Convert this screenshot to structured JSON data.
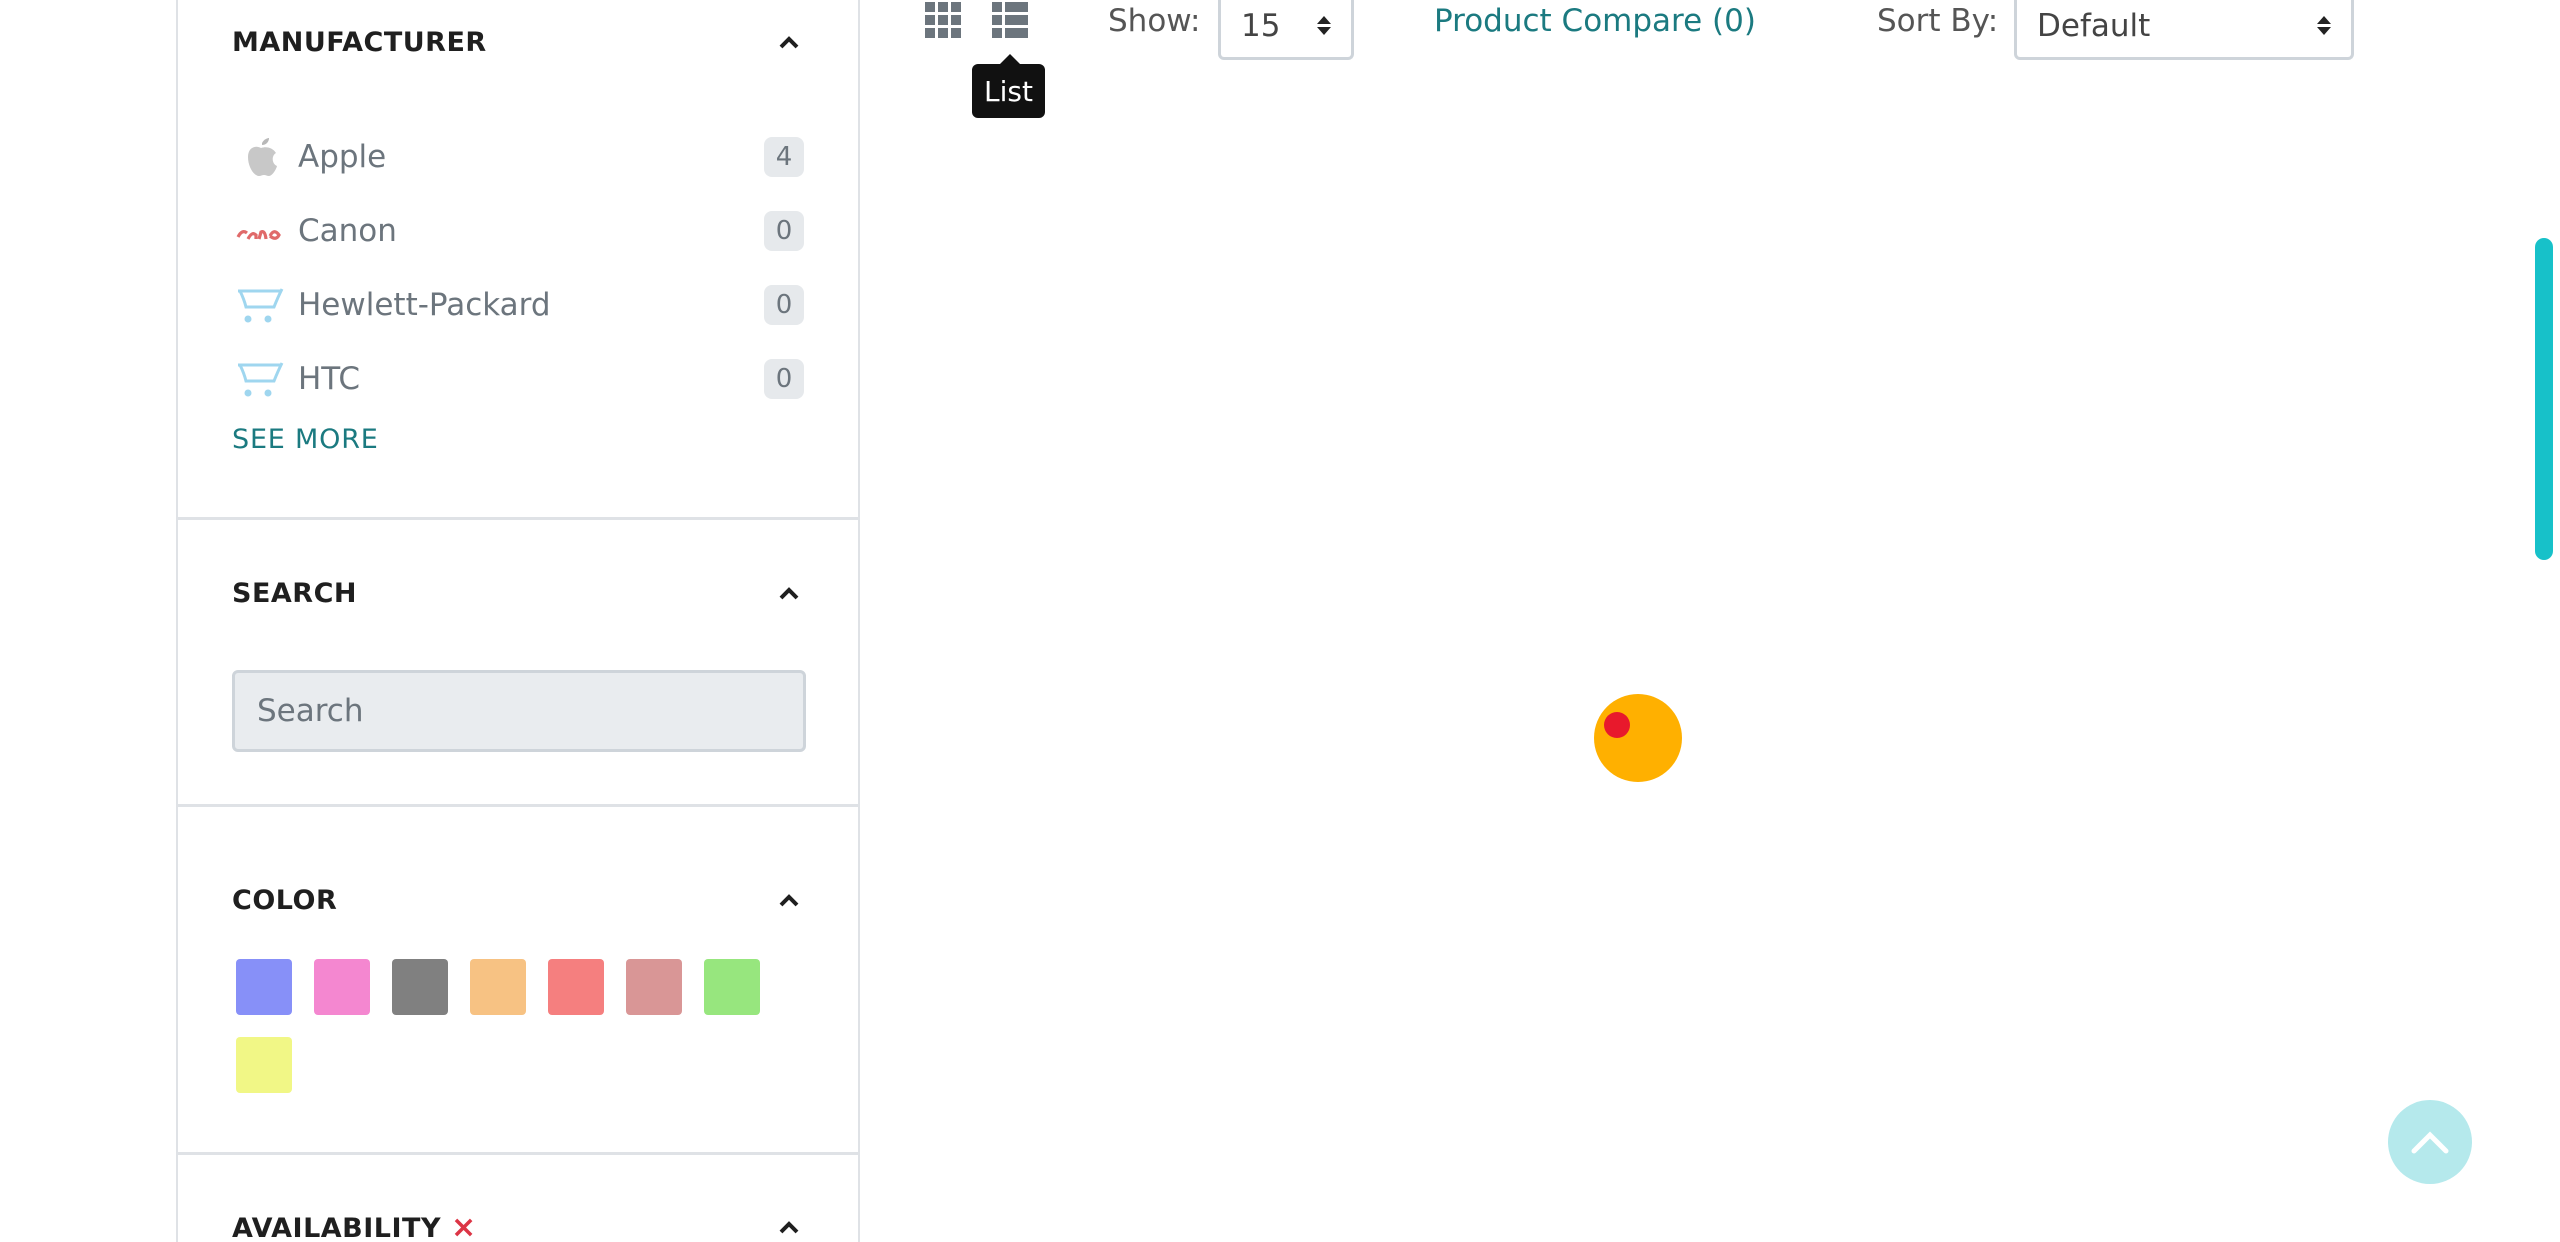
{
  "sidebar": {
    "manufacturer": {
      "title": "MANUFACTURER",
      "items": [
        {
          "name": "Apple",
          "count": "4",
          "logo_icon": "apple-logo-icon"
        },
        {
          "name": "Canon",
          "count": "0",
          "logo_icon": "canon-logo-icon"
        },
        {
          "name": "Hewlett-Packard",
          "count": "0",
          "logo_icon": "cart-placeholder-icon"
        },
        {
          "name": "HTC",
          "count": "0",
          "logo_icon": "cart-placeholder-icon"
        }
      ],
      "see_more": "SEE MORE"
    },
    "search": {
      "title": "SEARCH",
      "placeholder": "Search"
    },
    "color": {
      "title": "COLOR",
      "swatches": [
        "#8790f8",
        "#f487d0",
        "#808080",
        "#f7c283",
        "#f57f7f",
        "#d99696",
        "#97e67e",
        "#f1f786"
      ]
    },
    "availability": {
      "title": "AVAILABILITY",
      "clear_mark": "×"
    }
  },
  "toolbar": {
    "grid_icon": "grid-view-icon",
    "list_icon": "list-view-icon",
    "tooltip": "List",
    "show_label": "Show:",
    "show_value": "15",
    "compare_link": "Product Compare (0)",
    "sort_label": "Sort By:",
    "sort_value": "Default"
  },
  "colors": {
    "accent": "#1b7a80",
    "loader": "#ffb000",
    "loader_dot": "#e8192c",
    "scroll_thumb": "#17c1c9",
    "to_top": "#b5e9ec"
  }
}
